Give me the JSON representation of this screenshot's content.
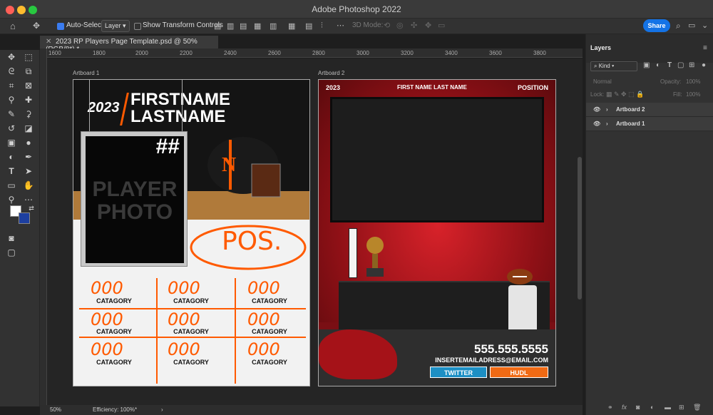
{
  "app_title": "Adobe Photoshop 2022",
  "options_bar": {
    "auto_select_label": "Auto-Select:",
    "auto_select_value": "Layer",
    "show_transform_label": "Show Transform Controls",
    "mode_3d_label": "3D Mode:",
    "share_label": "Share"
  },
  "document_tab": {
    "title": "2023 RP Players Page Template.psd @ 50% (RGB/8*) *"
  },
  "ruler": {
    "ticks": [
      "1600",
      "1800",
      "2000",
      "2200",
      "2400",
      "2600",
      "2800",
      "3000",
      "3200",
      "3400",
      "3600",
      "3800"
    ]
  },
  "artboard1": {
    "label": "Artboard 1",
    "year": "2023",
    "firstname": "FIRSTNAME",
    "lastname": "LASTNAME",
    "jersey": "##",
    "photo_line1": "PLAYER",
    "photo_line2": "PHOTO",
    "position": "POS.",
    "stat_value": "000",
    "stat_label": "CATAGORY"
  },
  "artboard2": {
    "label": "Artboard 2",
    "year": "2023",
    "name": "FIRST NAME LAST NAME",
    "position": "POSITION",
    "phone": "555.555.5555",
    "email": "INSERTEMAILADRESS@EMAIL.COM",
    "twitter": "TWITTER",
    "hudl": "HUDL",
    "colors": {
      "twitter": "#1d8fc4",
      "hudl": "#f06a14"
    }
  },
  "status_bar": {
    "zoom": "50%",
    "info": "Efficiency: 100%*"
  },
  "layers_panel": {
    "title": "Layers",
    "kind": "Kind",
    "blend_mode": "Normal",
    "opacity_label": "Opacity:",
    "opacity_value": "100%",
    "lock_label": "Lock:",
    "fill_label": "Fill:",
    "fill_value": "100%",
    "layers": [
      "Artboard 2",
      "Artboard 1"
    ]
  },
  "colors": {
    "accent": "#1473e6",
    "orange": "#ff5a00"
  }
}
